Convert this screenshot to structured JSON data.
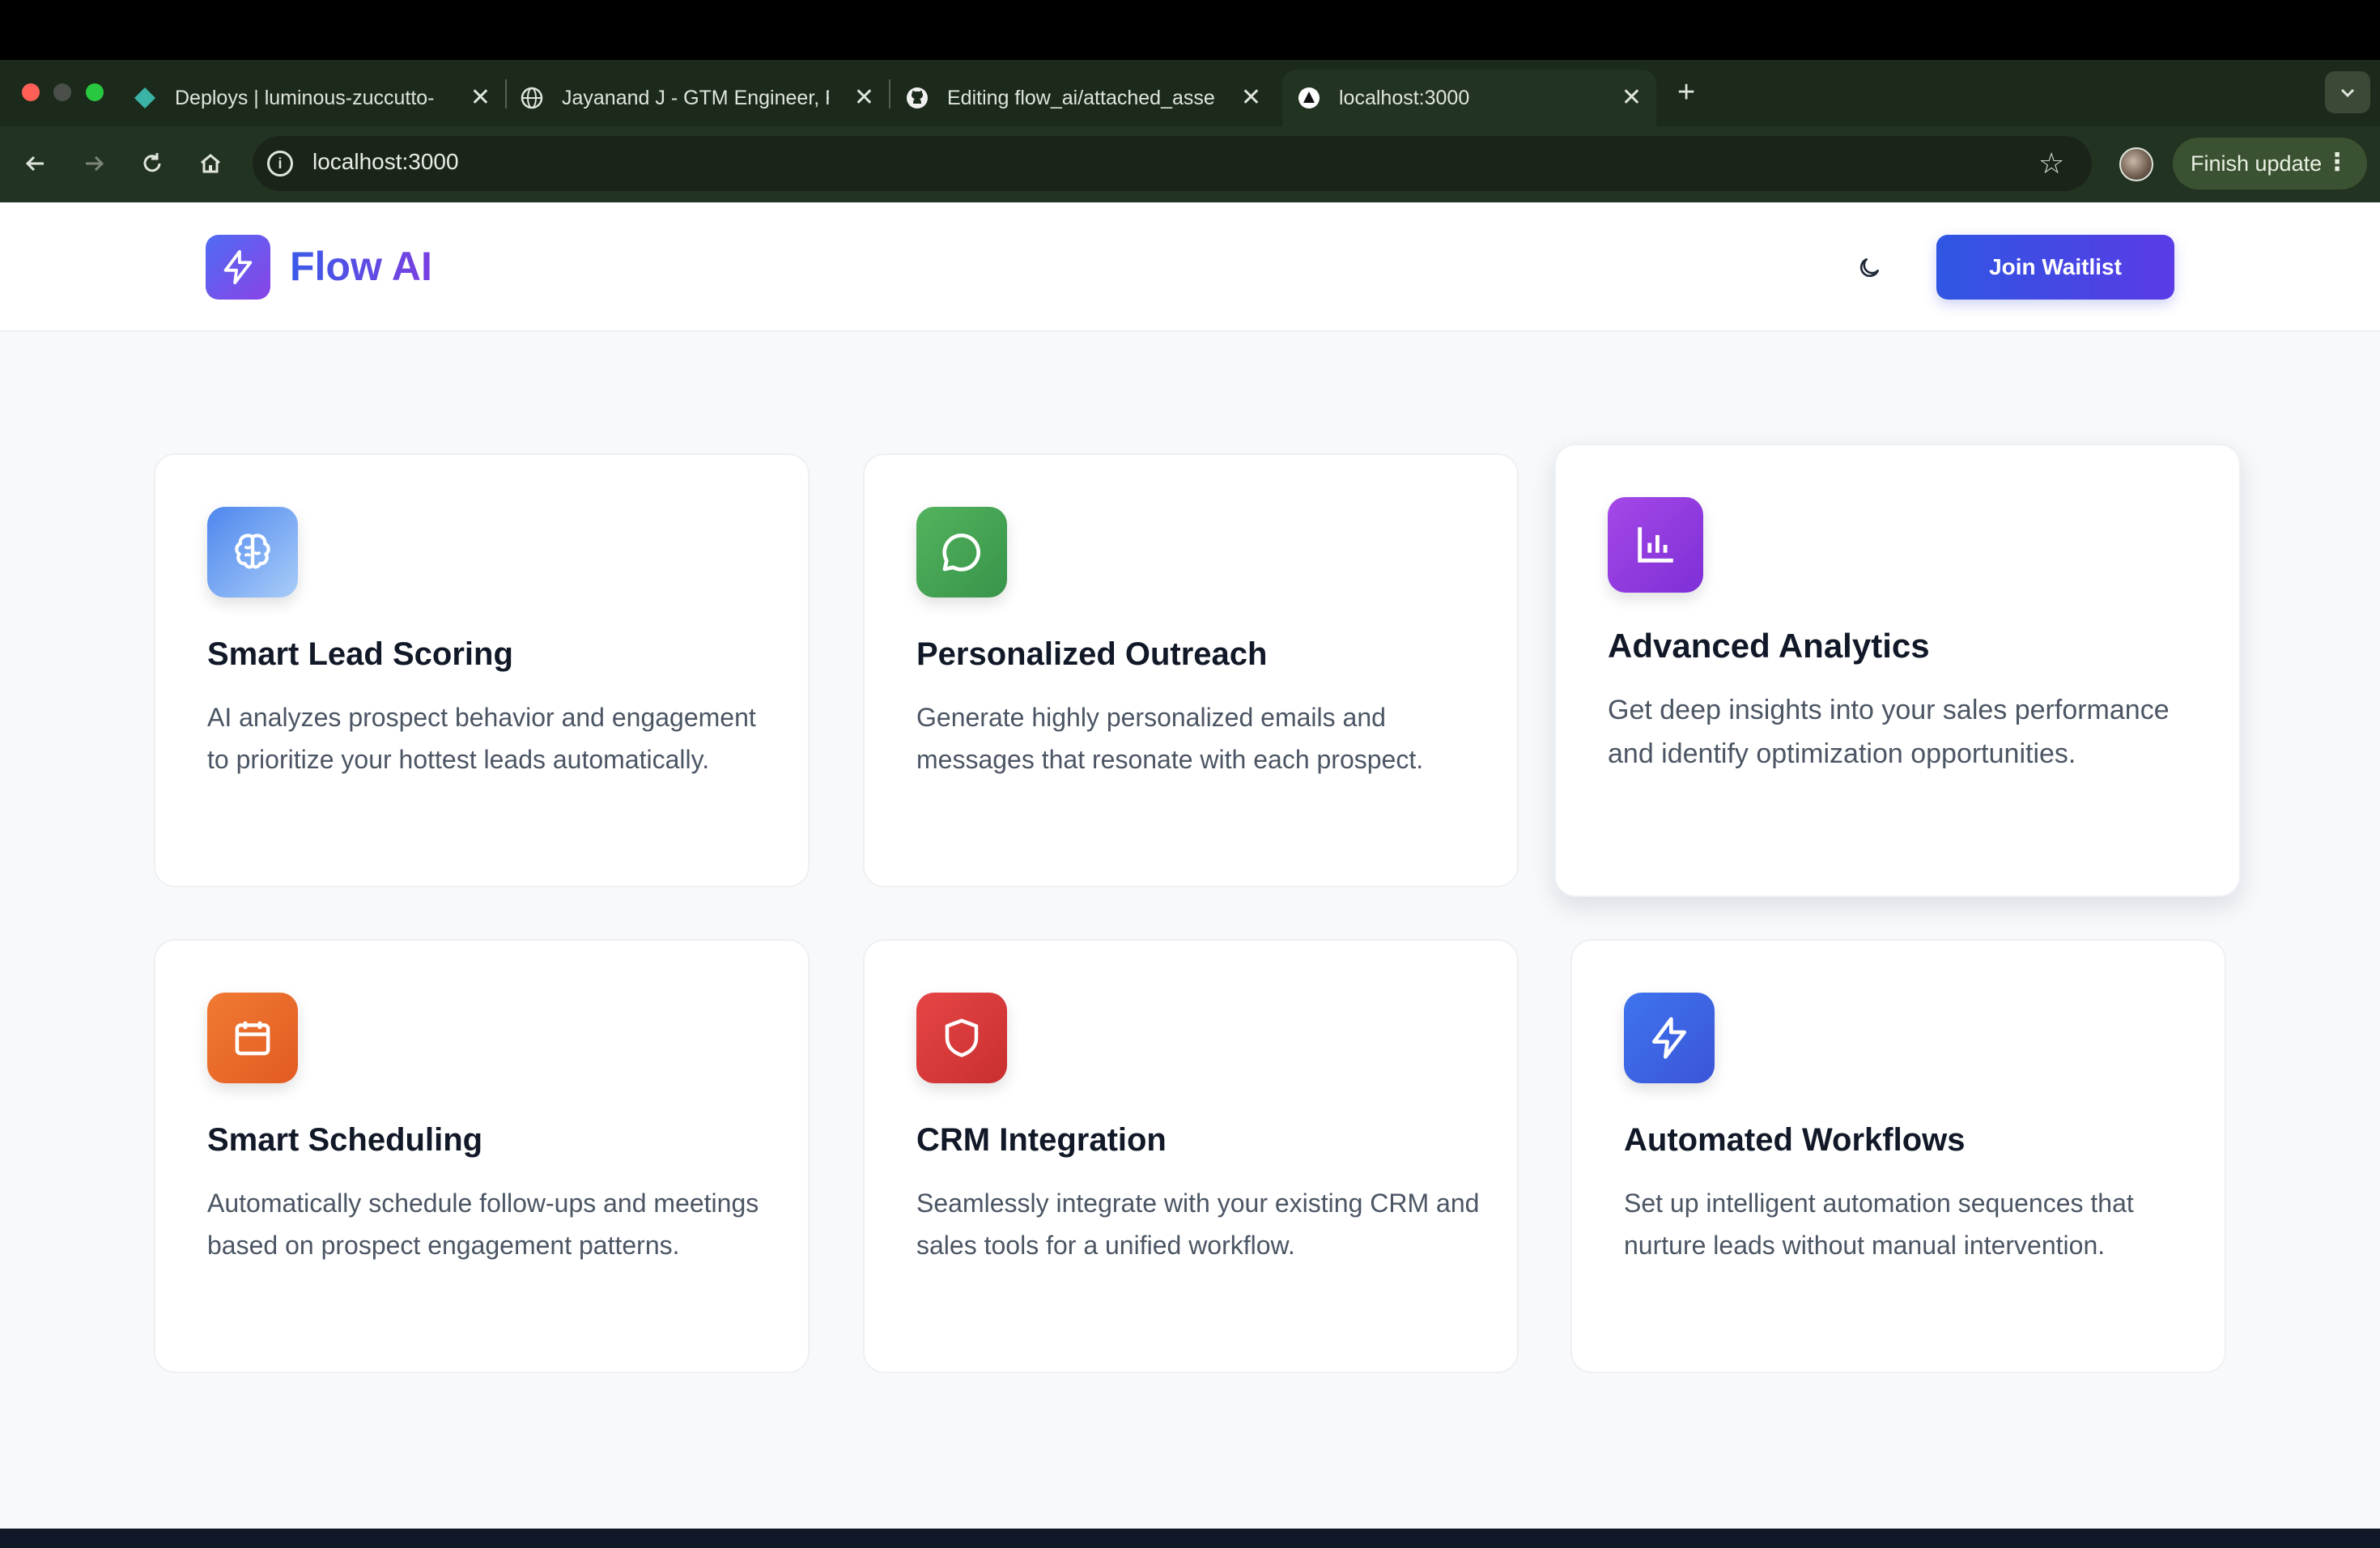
{
  "browser": {
    "tabs": [
      {
        "title": "Deploys | luminous-zuccutto-",
        "favicon": "netlify-diamond-icon"
      },
      {
        "title": "Jayanand J - GTM Engineer, F",
        "favicon": "globe-icon"
      },
      {
        "title": "Editing flow_ai/attached_asse",
        "favicon": "github-icon"
      },
      {
        "title": "localhost:3000",
        "favicon": "triangle-icon",
        "active": true
      }
    ],
    "url": "localhost:3000",
    "finish_update_label": "Finish update"
  },
  "site": {
    "brand": "Flow AI",
    "join_label": "Join Waitlist"
  },
  "features": [
    {
      "title": "Smart Lead Scoring",
      "desc": "AI analyzes prospect behavior and engagement to prioritize your hottest leads automatically.",
      "icon": "brain-icon",
      "color": "#5b8def"
    },
    {
      "title": "Personalized Outreach",
      "desc": "Generate highly personalized emails and messages that resonate with each prospect.",
      "icon": "message-icon",
      "color": "#43a84f"
    },
    {
      "title": "Advanced Analytics",
      "desc": "Get deep insights into your sales performance and identify optimization opportunities.",
      "icon": "bar-chart-icon",
      "color": "#9b3fe3"
    },
    {
      "title": "Smart Scheduling",
      "desc": "Automatically schedule follow-ups and meetings based on prospect engagement patterns.",
      "icon": "calendar-icon",
      "color": "#ea6a2b"
    },
    {
      "title": "CRM Integration",
      "desc": "Seamlessly integrate with your existing CRM and sales tools for a unified workflow.",
      "icon": "shield-icon",
      "color": "#d9383a"
    },
    {
      "title": "Automated Workflows",
      "desc": "Set up intelligent automation sequences that nurture leads without manual intervention.",
      "icon": "lightning-icon",
      "color": "#3b64e4"
    }
  ]
}
